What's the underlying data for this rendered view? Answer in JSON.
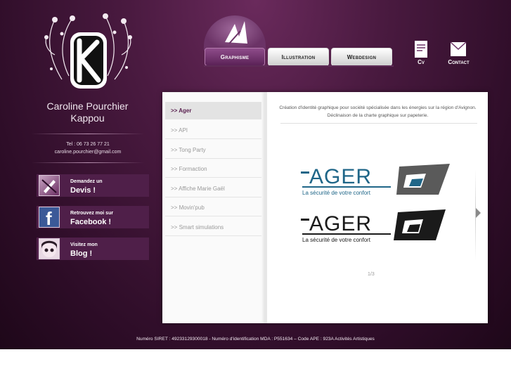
{
  "profile": {
    "name_line1": "Caroline Pourchier",
    "name_line2": "Kappou",
    "phone": "Tel : 06 73 26 77 21",
    "email": "caroline.pourchier@gmail.com"
  },
  "promos": [
    {
      "small": "Demandez un",
      "big": "Devis !"
    },
    {
      "small": "Retrouvez moi sur",
      "big": "Facebook !"
    },
    {
      "small": "Visitez mon",
      "big": "Blog !"
    }
  ],
  "nav": {
    "tabs": [
      "Graphisme",
      "Illustration",
      "Webdesign"
    ],
    "active_tab": "Graphisme",
    "cv_label": "Cv",
    "contact_label": "Contact"
  },
  "menu": {
    "items": [
      ">> Ager",
      ">> API",
      ">> Tong Party",
      ">> Formaction",
      ">> Affiche Marie Gaël",
      ">> Movin'pub",
      ">> Smart simulations"
    ],
    "active_index": 0
  },
  "project": {
    "desc_line1": "Création d'identité graphique pour société spécialisée dans les énergies sur la région d'Avignon.",
    "desc_line2": "Déclinaison de la charte graphique sur papeterie.",
    "logo_word": "AGER",
    "logo_tagline": "La sécurité de votre confort",
    "pager": "1/3"
  },
  "footer": {
    "text": "Numéro SIRET : 49233129300018 - Numéro d'identification MDA : P551634 – Code APE : 923A Activités Artistiques"
  },
  "colors": {
    "accent": "#5e2258",
    "ager_blue": "#1f6688",
    "ager_dark": "#1a1a1a"
  }
}
